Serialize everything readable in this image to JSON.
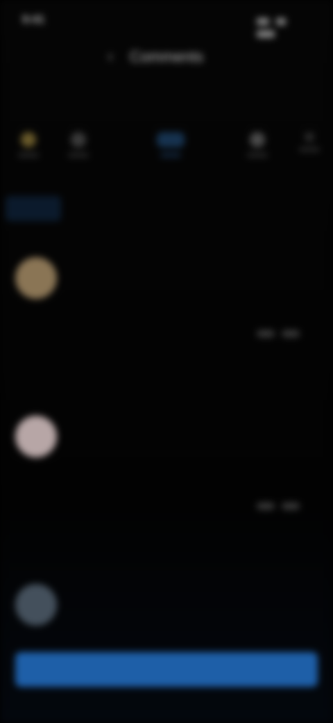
{
  "status_bar": {
    "time": "9:41"
  },
  "header": {
    "title": "Comments"
  },
  "subtitle": "",
  "tabs": [
    {
      "label": ""
    },
    {
      "label": ""
    },
    {
      "label": ""
    },
    {
      "label": ""
    }
  ],
  "media_row": {
    "icons": [
      "star-icon",
      "photo-icon",
      "video-icon",
      "music-icon",
      "more-icon"
    ]
  },
  "feed": {
    "posts": [
      {
        "author": "",
        "text": "",
        "time": "",
        "caption": "",
        "meta_name": ""
      },
      {
        "author": "",
        "text": "",
        "time": "",
        "caption": "",
        "meta_name": ""
      },
      {
        "author": "",
        "text": "",
        "time": "",
        "caption": "",
        "meta_name": ""
      }
    ]
  },
  "cta": {
    "label": ""
  },
  "colors": {
    "accent": "#1e5fa8",
    "link": "#3f6fb5",
    "background": "#000000"
  }
}
